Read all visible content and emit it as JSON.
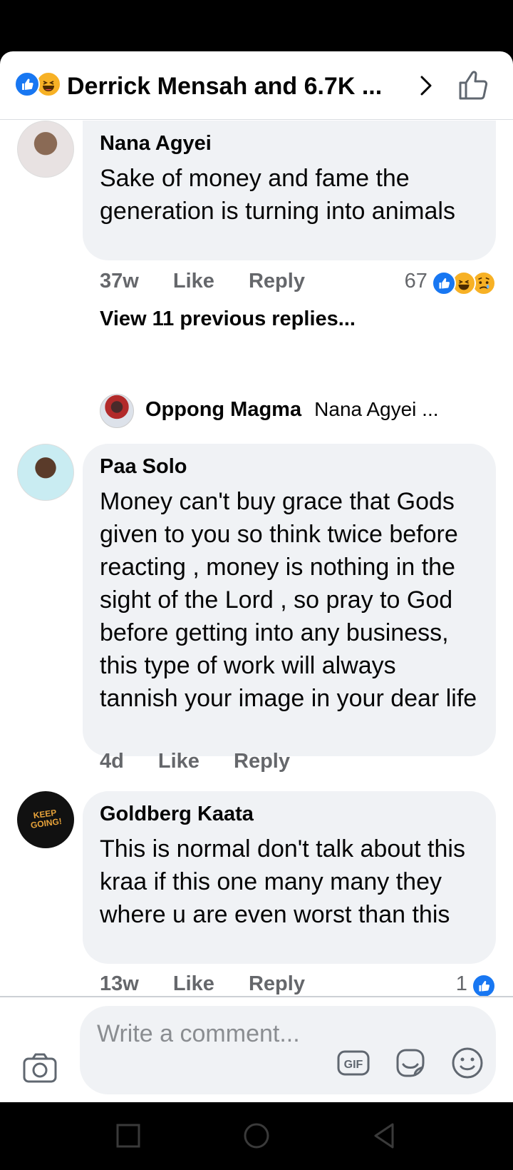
{
  "header": {
    "title": "Derrick Mensah and 6.7K ...",
    "reaction_icons": [
      "like-icon",
      "haha-icon"
    ]
  },
  "comments": [
    {
      "author": "Nana Agyei",
      "text": "Sake of money and fame the generation is turning into animals",
      "time": "37w",
      "like_label": "Like",
      "reply_label": "Reply",
      "reaction_count": "67",
      "reactions": [
        "like-icon",
        "haha-icon",
        "sad-icon"
      ],
      "view_previous": "View 11 previous replies...",
      "reply_preview": {
        "author": "Oppong  Magma",
        "text": "Nana Agyei ..."
      }
    },
    {
      "author": "Paa Solo",
      "text": "Money can't buy grace that Gods  given to you so think twice before reacting , money is nothing in the sight of the Lord , so pray to God before getting into any business, this type of work will always tannish your image in your dear life",
      "time": "4d",
      "like_label": "Like",
      "reply_label": "Reply"
    },
    {
      "author": "Goldberg Kaata",
      "avatar_text": "KEEP GOING!",
      "text": "This is normal don't talk about this kraa if this one many many they where u are even worst than this",
      "time": "13w",
      "like_label": "Like",
      "reply_label": "Reply",
      "reaction_count": "1",
      "reactions": [
        "like-icon"
      ]
    }
  ],
  "composer": {
    "placeholder": "Write a comment...",
    "icons": [
      "camera-icon",
      "gif-icon",
      "sticker-icon",
      "emoji-icon"
    ]
  },
  "colors": {
    "facebook_blue": "#1877f2",
    "haha_yellow": "#f7b125",
    "bubble_bg": "#f0f2f5",
    "meta_gray": "#65676b"
  }
}
